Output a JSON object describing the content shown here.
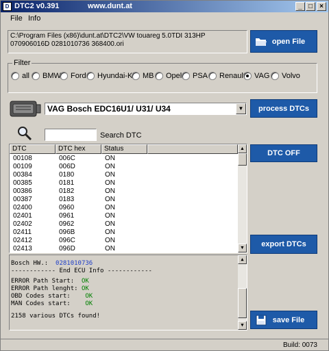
{
  "window": {
    "title": "DTC2 v0.391",
    "url": "www.dunt.at",
    "min_label": "_",
    "max_label": "□",
    "close_label": "×"
  },
  "menu": {
    "items": [
      "File",
      "Info"
    ]
  },
  "path_text": "C:\\Program Files (x86)\\dunt.at\\DTC2\\VW touareg 5.0TDI 313HP 070906016D 0281010736 368400.ori",
  "buttons": {
    "open_file": "open File",
    "process_dtcs": "process DTCs",
    "dtc_off": "DTC OFF",
    "export_dtcs": "export DTCs",
    "save_file": "save File"
  },
  "filter": {
    "label": "Filter",
    "options": [
      "all",
      "BMW",
      "Ford",
      "Hyundai-Kia",
      "MB",
      "Opel",
      "PSA",
      "Renault",
      "VAG",
      "Volvo"
    ],
    "selected": "VAG"
  },
  "ecu_select": {
    "value": "VAG Bosch EDC16U1/ U31/ U34"
  },
  "search": {
    "label": "Search DTC",
    "value": ""
  },
  "dtc_table": {
    "columns": [
      "DTC",
      "DTC hex",
      "Status"
    ],
    "rows": [
      [
        "00108",
        "006C",
        "ON"
      ],
      [
        "00109",
        "006D",
        "ON"
      ],
      [
        "00384",
        "0180",
        "ON"
      ],
      [
        "00385",
        "0181",
        "ON"
      ],
      [
        "00386",
        "0182",
        "ON"
      ],
      [
        "00387",
        "0183",
        "ON"
      ],
      [
        "02400",
        "0960",
        "ON"
      ],
      [
        "02401",
        "0961",
        "ON"
      ],
      [
        "02402",
        "0962",
        "ON"
      ],
      [
        "02411",
        "096B",
        "ON"
      ],
      [
        "02412",
        "096C",
        "ON"
      ],
      [
        "02413",
        "096D",
        "ON"
      ]
    ]
  },
  "log": {
    "bosch_hw_label": "Bosch HW.:",
    "bosch_hw_value": "0281010736",
    "end_info": "------------ End ECU Info ------------",
    "checks": [
      {
        "label": "ERROR Path Start:",
        "value": "OK"
      },
      {
        "label": "ERROR Path lenght:",
        "value": "OK"
      },
      {
        "label": "OBD Codes start:",
        "value": "OK"
      },
      {
        "label": "MAN Codes start:",
        "value": "OK"
      }
    ],
    "result": "2158 various DTCs found!"
  },
  "status": {
    "build": "Build: 0073"
  },
  "colors": {
    "accent": "#1e5aa8",
    "title_start": "#0a246a",
    "title_end": "#a6caf0",
    "ok_green": "#008000",
    "hw_blue": "#1e3ec8"
  },
  "icons": {
    "folder": "folder-icon",
    "ecu": "ecu-module-icon",
    "search": "magnifier-icon",
    "save": "floppy-disk-icon"
  }
}
